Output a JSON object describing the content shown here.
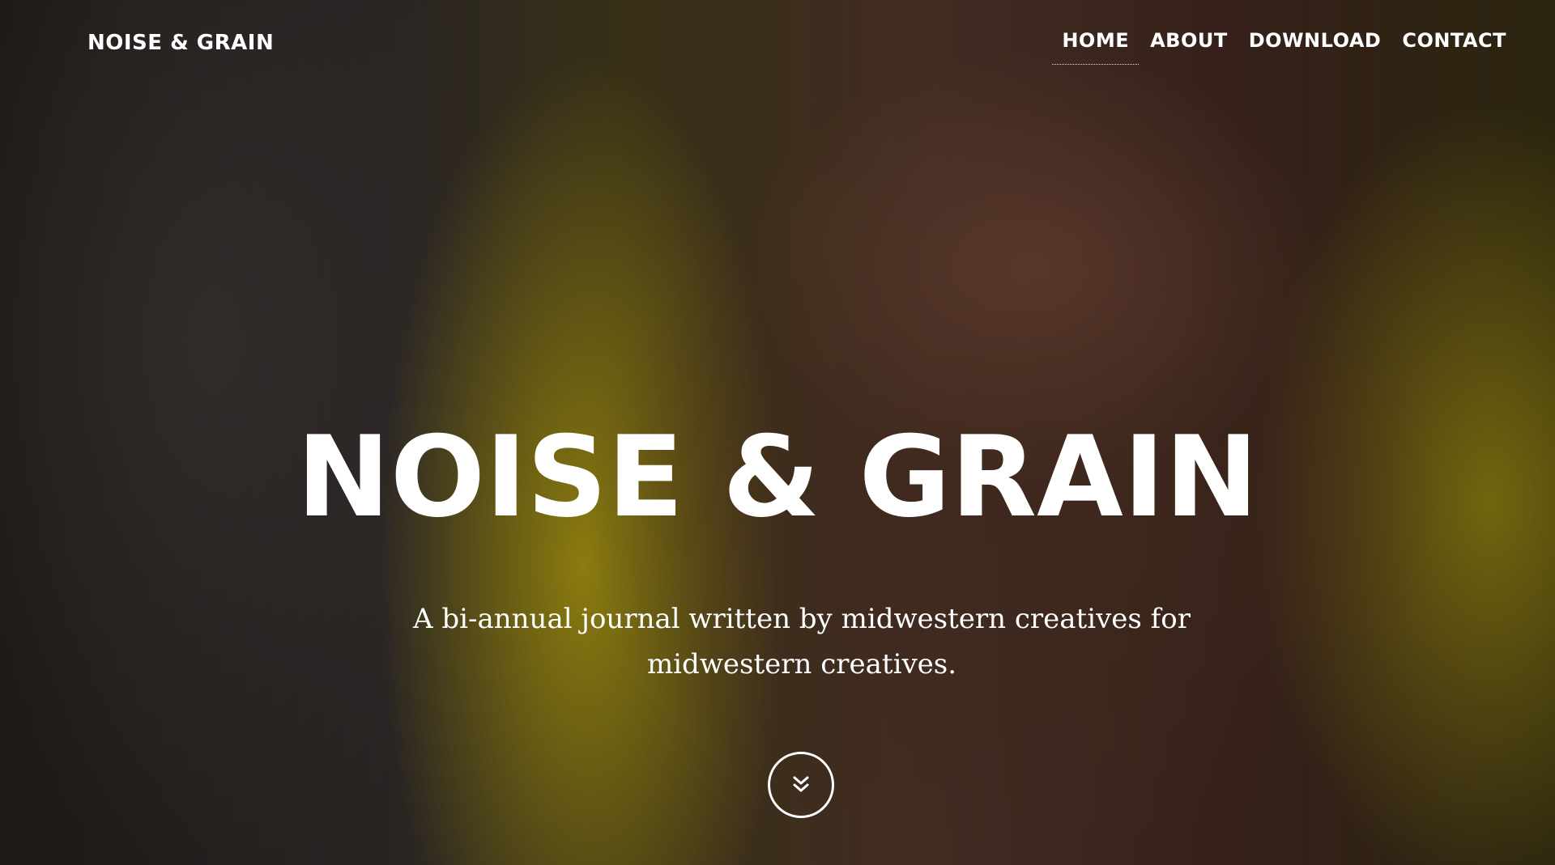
{
  "header": {
    "brand": "NOISE & GRAIN",
    "nav": [
      {
        "label": "HOME",
        "active": true
      },
      {
        "label": "ABOUT",
        "active": false
      },
      {
        "label": "DOWNLOAD",
        "active": false
      },
      {
        "label": "CONTACT",
        "active": false
      }
    ]
  },
  "hero": {
    "title": "NOISE & GRAIN",
    "tagline": "A bi-annual journal written by midwestern creatives for midwestern creatives.",
    "scroll_icon": "double-chevron-down-icon"
  },
  "colors": {
    "text": "#ffffff",
    "accent_yellow": "#cdb614"
  }
}
